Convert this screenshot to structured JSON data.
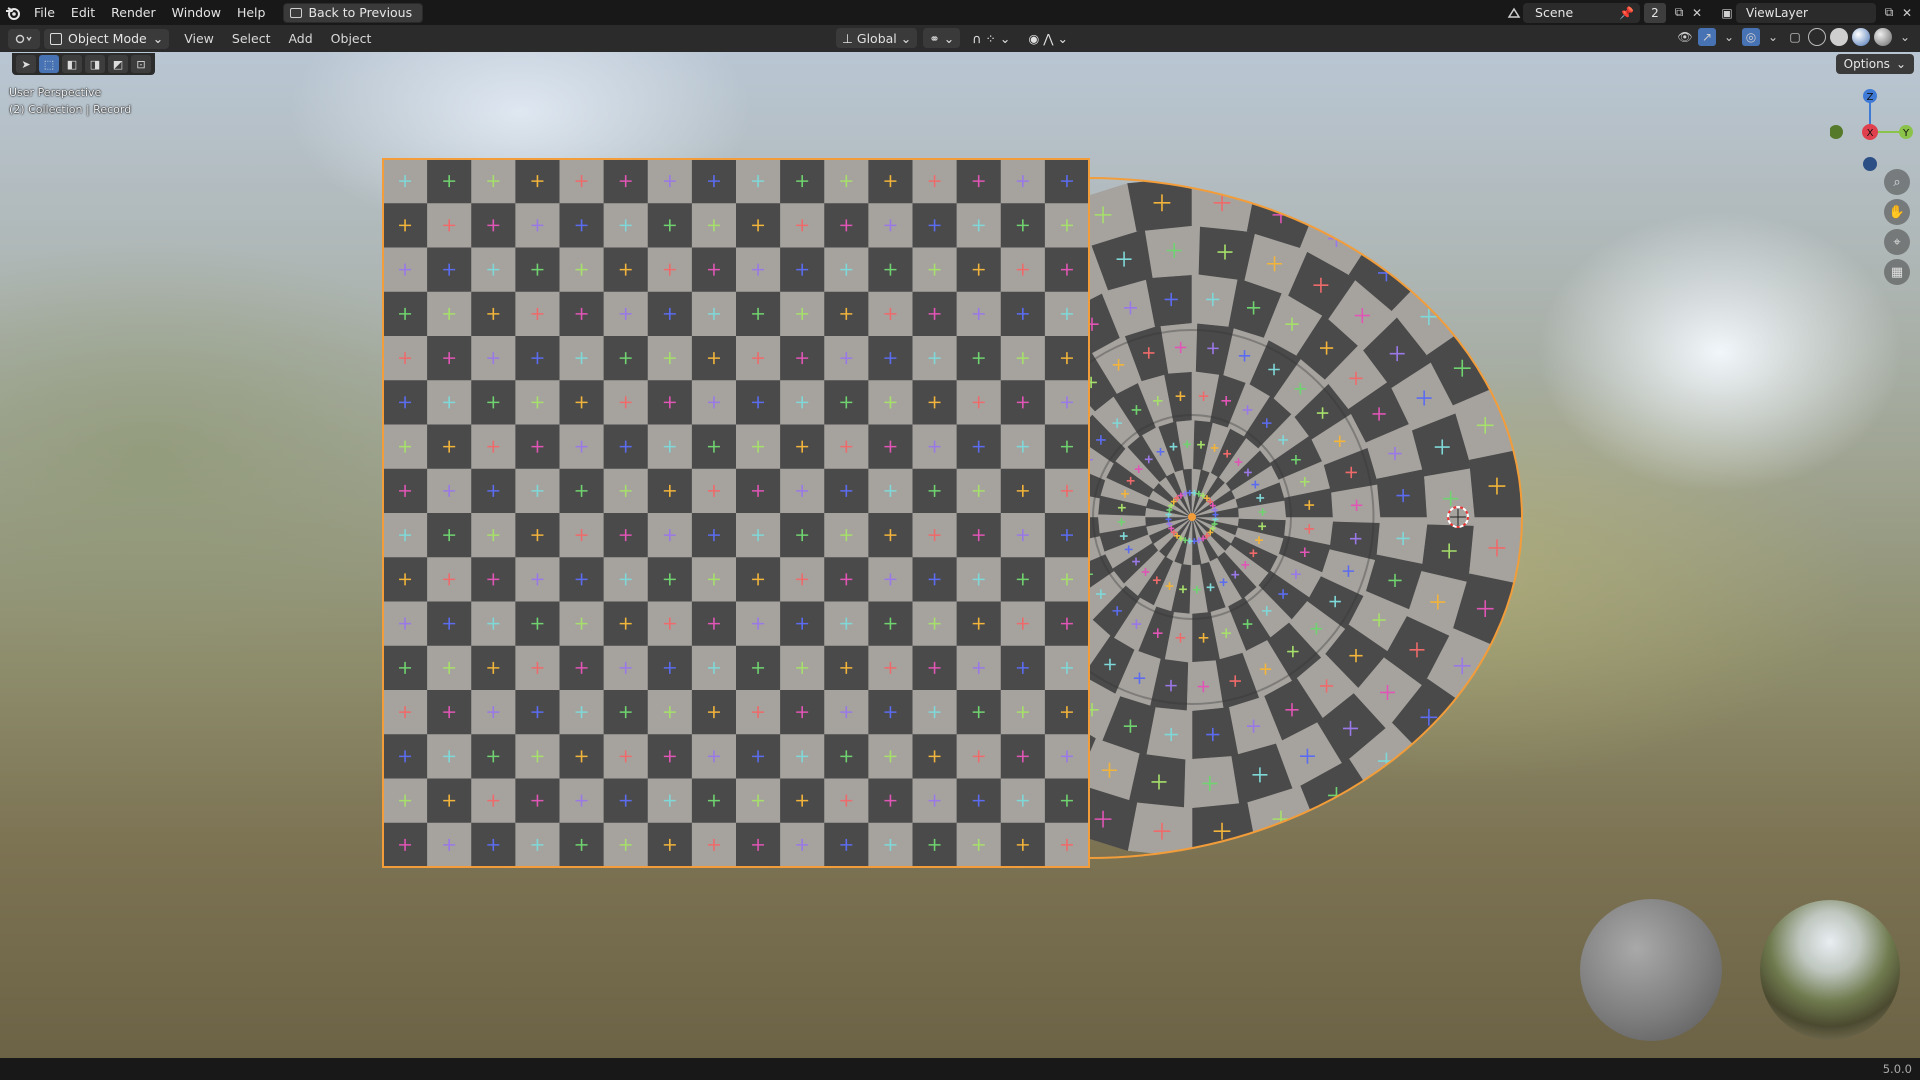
{
  "topbar": {
    "menus": [
      "File",
      "Edit",
      "Render",
      "Window",
      "Help"
    ],
    "back_label": "Back to Previous",
    "scene_name": "Scene",
    "scene_count": "2",
    "view_layer": "ViewLayer"
  },
  "header": {
    "mode": "Object Mode",
    "menus": [
      "View",
      "Select",
      "Add",
      "Object"
    ],
    "transform_orientation": "Global"
  },
  "viewport": {
    "perspective_label": "User Perspective",
    "collection_label": "(2) Collection | Record",
    "options_label": "Options",
    "gizmo_axes": {
      "z": "Z",
      "x": "X",
      "y": "Y"
    }
  },
  "status": {
    "version": "5.0.0"
  },
  "colors": {
    "accent": "#4772b3",
    "selection_outline": "#f29d3a",
    "axis_x": "#e0404d",
    "axis_y": "#8bc34a",
    "axis_z": "#3f7ad6",
    "checker_light": "#a6a39f",
    "checker_dark": "#4a4a4a"
  },
  "icons": {
    "logo": "blender-logo-icon",
    "zoom": "zoom-icon",
    "pan": "hand-icon",
    "camera": "camera-icon",
    "ortho": "grid-icon"
  }
}
